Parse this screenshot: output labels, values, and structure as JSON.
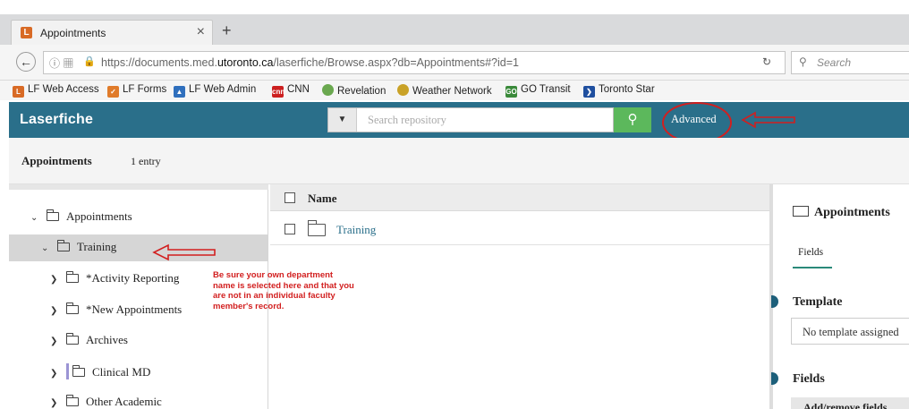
{
  "browser": {
    "tab_title": "Appointments",
    "tab_icon": "L",
    "close_glyph": "×",
    "newtab_glyph": "+",
    "url_prefix": "https://documents.med.",
    "url_domain": "utoronto.ca",
    "url_suffix": "/laserfiche/Browse.aspx?db=Appointments#?id=1",
    "search_placeholder": "Search"
  },
  "bookmarks": [
    {
      "label": "LF Web Access",
      "color": "#d86a25"
    },
    {
      "label": "LF Forms",
      "color": "#e07b2a"
    },
    {
      "label": "LF Web Admin",
      "color": "#2f6fbd"
    },
    {
      "label": "CNN",
      "color": "#cc1f1f"
    },
    {
      "label": "Revelation",
      "color": "#6aa84f"
    },
    {
      "label": "Weather Network",
      "color": "#c9a227"
    },
    {
      "label": "GO Transit",
      "color": "#3a8a3a"
    },
    {
      "label": "Toronto Star",
      "color": "#1f4f9f"
    }
  ],
  "app": {
    "logo": "Laserfiche",
    "search_placeholder": "Search repository",
    "advanced": "Advanced",
    "accent": "#2a6f8a",
    "go_color": "#5cb85c"
  },
  "header": {
    "title": "Appointments",
    "count": "1 entry"
  },
  "tree": [
    {
      "label": "Appointments",
      "expanded": true
    },
    {
      "label": "Training",
      "expanded": true,
      "selected": true
    },
    {
      "label": "*Activity Reporting"
    },
    {
      "label": "*New Appointments"
    },
    {
      "label": "Archives"
    },
    {
      "label": "Clinical MD"
    },
    {
      "label": "Other Academic"
    }
  ],
  "list": {
    "column_name": "Name",
    "rows": [
      {
        "name": "Training"
      }
    ]
  },
  "panel": {
    "title": "Appointments",
    "tab_fields": "Fields",
    "template_heading": "Template",
    "template_value": "No template assigned",
    "fields_heading": "Fields",
    "add_remove": "Add/remove fields"
  },
  "annotation": "Be sure your own department name is selected here and that you are not in an individual faculty member's record."
}
